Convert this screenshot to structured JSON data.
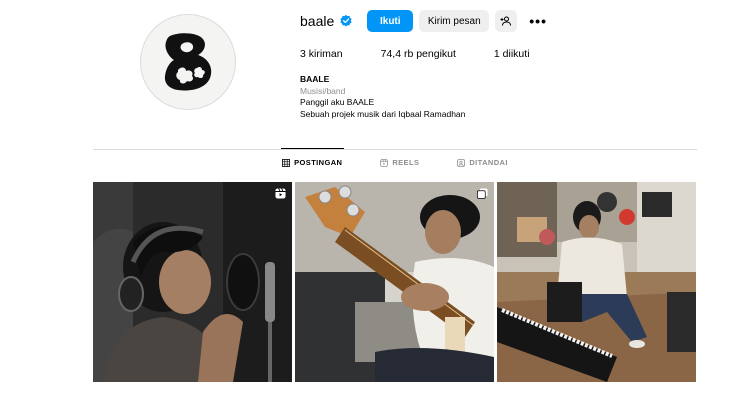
{
  "profile": {
    "username": "baale",
    "follow_label": "Ikuti",
    "message_label": "Kirim pesan",
    "more_label": "•••",
    "stats": {
      "posts": "3 kiriman",
      "followers": "74,4 rb pengikut",
      "following": "1 diikuti"
    },
    "bio": {
      "name": "BAALE",
      "category": "Musisi/band",
      "line1": "Panggil aku BAALE",
      "line2": "Sebuah projek musik dari Iqbaal Ramadhan"
    }
  },
  "tabs": [
    {
      "label": "POSTINGAN",
      "icon": "grid-icon",
      "active": true
    },
    {
      "label": "REELS",
      "icon": "reels-icon",
      "active": false
    },
    {
      "label": "DITANDAI",
      "icon": "tagged-icon",
      "active": false
    }
  ],
  "posts": [
    {
      "badge": "reel-icon",
      "subject": "singer-with-headphones"
    },
    {
      "badge": "carousel-icon",
      "subject": "bass-guitar-player"
    },
    {
      "badge": "",
      "subject": "musician-in-studio"
    }
  ],
  "colors": {
    "primary": "#0095f6",
    "secondary": "#efefef",
    "muted": "#8e8e8e",
    "divider": "#dbdbdb"
  }
}
